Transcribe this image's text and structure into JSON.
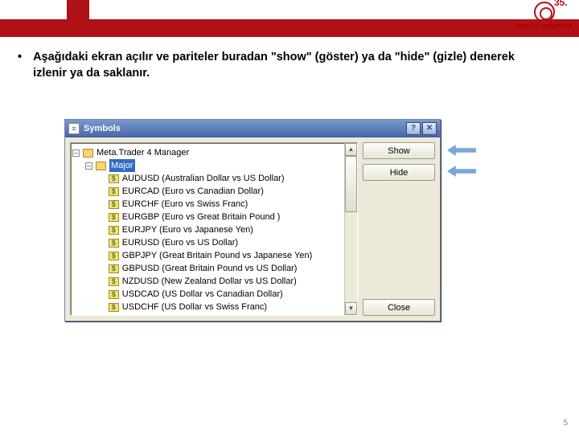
{
  "logo": {
    "anniversary": "35.",
    "text": "MENKUL DEĞERLER"
  },
  "bullet": "Aşağıdaki ekran açılır ve pariteler buradan \"show\" (göster) ya da \"hide\" (gizle) denerek izlenir ya da saklanır.",
  "dialog": {
    "title": "Symbols",
    "help_btn": "?",
    "close_btn": "✕",
    "btn_show": "Show",
    "btn_hide": "Hide",
    "btn_close": "Close",
    "root": "Meta.Trader 4 Manager",
    "group": "Major",
    "items": [
      {
        "sym": "AUDUSD",
        "desc": "(Australian Dollar vs US Dollar)"
      },
      {
        "sym": "EURCAD",
        "desc": "(Euro vs Canadian Dollar)"
      },
      {
        "sym": "EURCHF",
        "desc": "(Euro vs Swiss Franc)"
      },
      {
        "sym": "EURGBP",
        "desc": "(Euro vs Great Britain Pound )"
      },
      {
        "sym": "EURJPY",
        "desc": "(Euro vs Japanese Yen)"
      },
      {
        "sym": "EURUSD",
        "desc": "(Euro vs US Dollar)"
      },
      {
        "sym": "GBPJPY",
        "desc": "(Great Britain Pound vs Japanese Yen)"
      },
      {
        "sym": "GBPUSD",
        "desc": "(Great Britain Pound vs US Dollar)"
      },
      {
        "sym": "NZDUSD",
        "desc": "(New Zealand Dollar vs US Dollar)"
      },
      {
        "sym": "USDCAD",
        "desc": "(US Dollar vs Canadian Dollar)"
      },
      {
        "sym": "USDCHF",
        "desc": "(US Dollar vs Swiss Franc)"
      }
    ]
  },
  "page_number": "5"
}
